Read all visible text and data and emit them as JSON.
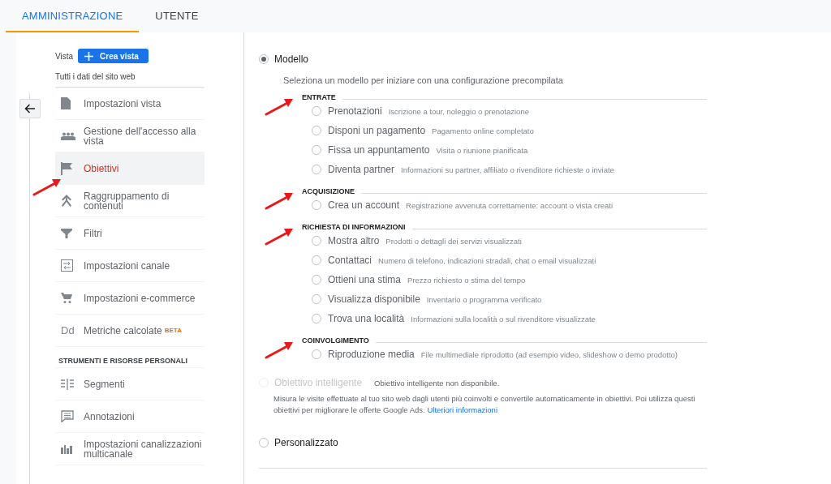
{
  "tabs": [
    {
      "label": "AMMINISTRAZIONE",
      "selected": true
    },
    {
      "label": "UTENTE",
      "selected": false
    }
  ],
  "sidebar": {
    "view_label": "Vista",
    "create_button": "Crea vista",
    "view_name": "Tutti i dati del sito web",
    "items": [
      {
        "kind": "item",
        "label": "Impostazioni vista",
        "selected": false,
        "annotated": false
      },
      {
        "kind": "item",
        "label": "Gestione dell'accesso alla vista",
        "selected": false,
        "annotated": false
      },
      {
        "kind": "item",
        "label": "Obiettivi",
        "selected": true,
        "annotated": true
      },
      {
        "kind": "item",
        "label": "Raggruppamento di contenuti",
        "selected": false,
        "annotated": false
      },
      {
        "kind": "item",
        "label": "Filtri",
        "selected": false,
        "annotated": false
      },
      {
        "kind": "item",
        "label": "Impostazioni canale",
        "selected": false,
        "annotated": false
      },
      {
        "kind": "item",
        "label": "Impostazioni e-commerce",
        "selected": false,
        "annotated": false
      },
      {
        "kind": "item",
        "label": "Metriche calcolate",
        "icon_text": "Dd",
        "badge": "BETA",
        "selected": false,
        "annotated": false
      },
      {
        "kind": "heading",
        "label": "STRUMENTI E RISORSE PERSONALI"
      },
      {
        "kind": "item",
        "label": "Segmenti",
        "selected": false,
        "annotated": false
      },
      {
        "kind": "item",
        "label": "Annotazioni",
        "selected": false,
        "annotated": false
      },
      {
        "kind": "item",
        "label": "Impostazioni canalizzazioni multicanale",
        "selected": false,
        "annotated": false
      }
    ]
  },
  "goal_types": [
    {
      "kind": "template",
      "label": "Modello",
      "selected": true,
      "disabled": false,
      "description": "Seleziona un modello per iniziare con una configurazione precompilata",
      "sections": [
        {
          "heading": "ENTRATE",
          "annotated": true,
          "options": [
            {
              "label": "Prenotazioni",
              "description": "Iscrizione a tour, noleggio o prenotazione",
              "selected": false
            },
            {
              "label": "Disponi un pagamento",
              "description": "Pagamento online completato",
              "selected": false
            },
            {
              "label": "Fissa un appuntamento",
              "description": "Visita o riunione pianificata",
              "selected": false
            },
            {
              "label": "Diventa partner",
              "description": "Informazioni su partner, affiliato o rivenditore richieste o inviate",
              "selected": false
            }
          ]
        },
        {
          "heading": "ACQUISIZIONE",
          "annotated": true,
          "options": [
            {
              "label": "Crea un account",
              "description": "Registrazione avvenuta correttamente: account o vista creati",
              "selected": false
            }
          ]
        },
        {
          "heading": "RICHIESTA DI INFORMAZIONI",
          "annotated": true,
          "options": [
            {
              "label": "Mostra altro",
              "description": "Prodotti o dettagli dei servizi visualizzati",
              "selected": false
            },
            {
              "label": "Contattaci",
              "description": "Numero di telefono, indicazioni stradali, chat o email visualizzati",
              "selected": false
            },
            {
              "label": "Ottieni una stima",
              "description": "Prezzo richiesto o stima del tempo",
              "selected": false
            },
            {
              "label": "Visualizza disponibile",
              "description": "Inventario o programma verificato",
              "selected": false
            },
            {
              "label": "Trova una località",
              "description": "Informazioni sulla località o sul rivenditore visualizzate",
              "selected": false
            }
          ]
        },
        {
          "heading": "COINVOLGIMENTO",
          "annotated": true,
          "options": [
            {
              "label": "Riproduzione media",
              "description": "File multimediale riprodotto (ad esempio video, slideshow o demo prodotto)",
              "selected": false
            }
          ]
        }
      ]
    },
    {
      "kind": "smart",
      "label": "Obiettivo intelligente",
      "selected": false,
      "disabled": true,
      "note": "Obiettivo intelligente non disponibile.",
      "description": "Misura le visite effettuate al tuo sito web dagli utenti più coinvolti e convertile automaticamente in obiettivi. Poi utilizza questi obiettivi per migliorare le offerte Google Ads.",
      "link": "Ulteriori informazioni"
    },
    {
      "kind": "custom",
      "label": "Personalizzato",
      "selected": false,
      "disabled": false
    }
  ]
}
